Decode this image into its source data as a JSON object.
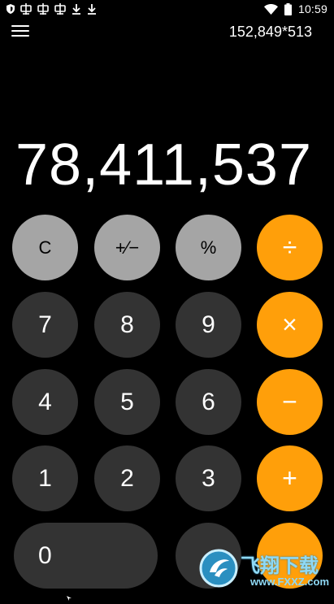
{
  "status_bar": {
    "time": "10:59",
    "left_icons": [
      "shield-icon",
      "notification-icon",
      "notification-icon",
      "notification-icon",
      "download-icon",
      "download-icon"
    ],
    "right_icons": [
      "wifi-icon",
      "battery-icon"
    ]
  },
  "header": {
    "menu_icon": "hamburger-menu-icon",
    "expression": "152,849*513"
  },
  "display": {
    "result": "78,411,537"
  },
  "keypad": {
    "rows": [
      [
        {
          "label": "C",
          "type": "function"
        },
        {
          "label": "+⁄−",
          "type": "function"
        },
        {
          "label": "%",
          "type": "function"
        },
        {
          "label": "÷",
          "type": "operator"
        }
      ],
      [
        {
          "label": "7",
          "type": "digit"
        },
        {
          "label": "8",
          "type": "digit"
        },
        {
          "label": "9",
          "type": "digit"
        },
        {
          "label": "×",
          "type": "operator"
        }
      ],
      [
        {
          "label": "4",
          "type": "digit"
        },
        {
          "label": "5",
          "type": "digit"
        },
        {
          "label": "6",
          "type": "digit"
        },
        {
          "label": "−",
          "type": "operator"
        }
      ],
      [
        {
          "label": "1",
          "type": "digit"
        },
        {
          "label": "2",
          "type": "digit"
        },
        {
          "label": "3",
          "type": "digit"
        },
        {
          "label": "+",
          "type": "operator"
        }
      ],
      [
        {
          "label": "0",
          "type": "digit"
        },
        {
          "label": "",
          "type": "digit"
        },
        {
          "label": "",
          "type": "operator"
        }
      ]
    ]
  },
  "colors": {
    "background": "#000000",
    "function_key": "#a5a5a5",
    "digit_key": "#333333",
    "operator_key": "#ff9f0a"
  },
  "watermark": {
    "title": "飞翔下载",
    "subtitle": "www.FXXZ.com"
  }
}
